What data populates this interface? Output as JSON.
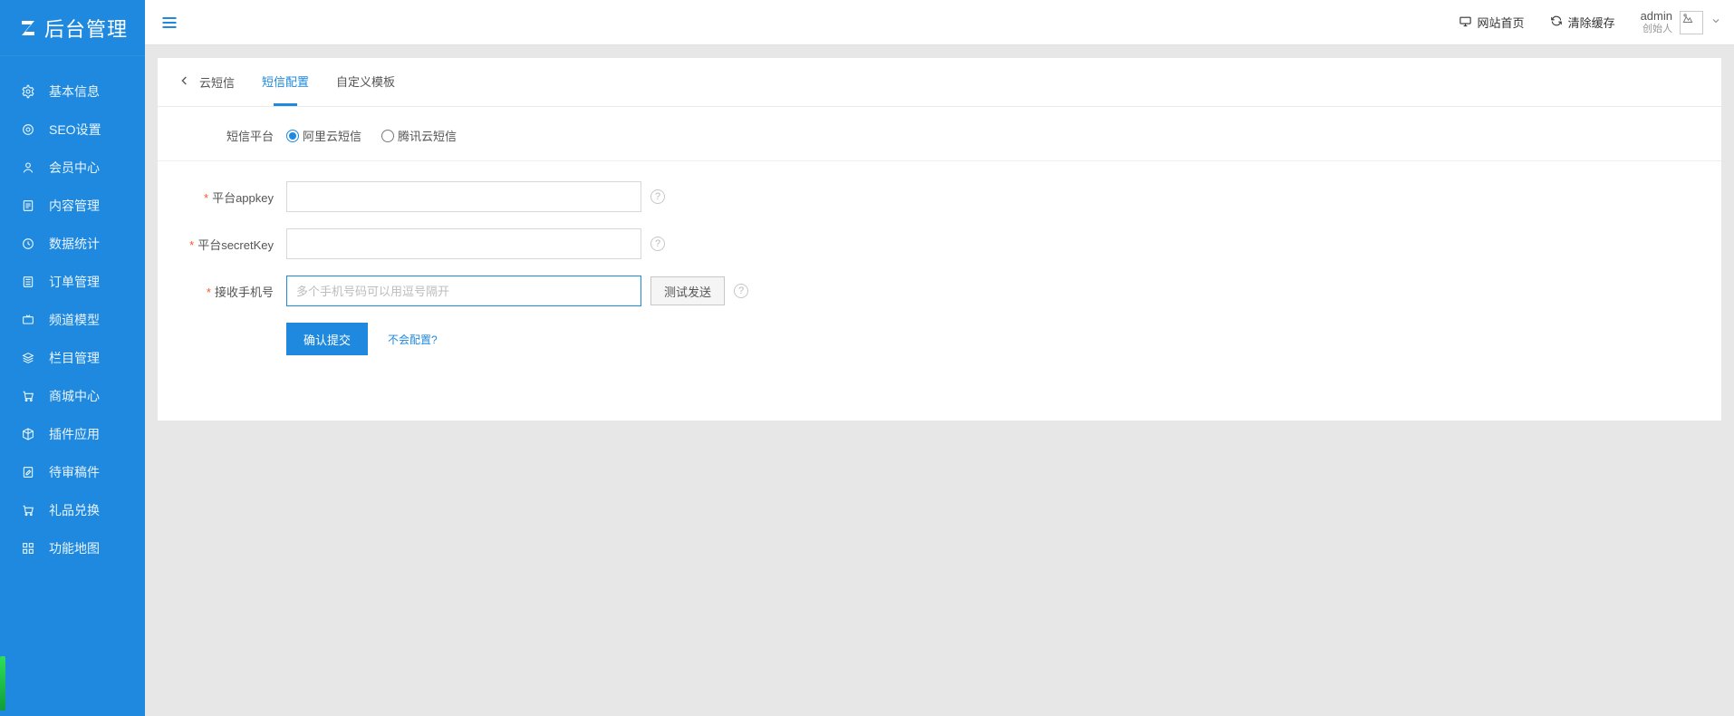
{
  "brand": {
    "text": "后台管理"
  },
  "sidebar": {
    "items": [
      {
        "label": "基本信息"
      },
      {
        "label": "SEO设置"
      },
      {
        "label": "会员中心"
      },
      {
        "label": "内容管理"
      },
      {
        "label": "数据统计"
      },
      {
        "label": "订单管理"
      },
      {
        "label": "频道模型"
      },
      {
        "label": "栏目管理"
      },
      {
        "label": "商城中心"
      },
      {
        "label": "插件应用"
      },
      {
        "label": "待审稿件"
      },
      {
        "label": "礼品兑换"
      },
      {
        "label": "功能地图"
      }
    ]
  },
  "topbar": {
    "home": "网站首页",
    "clear_cache": "清除缓存",
    "user_name": "admin",
    "user_role": "创始人"
  },
  "tabs": {
    "back": "云短信",
    "config": "短信配置",
    "template": "自定义模板"
  },
  "form": {
    "platform_label": "短信平台",
    "radio_aliyun": "阿里云短信",
    "radio_tencent": "腾讯云短信",
    "appkey_label": "平台appkey",
    "secret_label": "平台secretKey",
    "phone_label": "接收手机号",
    "phone_placeholder": "多个手机号码可以用逗号隔开",
    "test_btn": "测试发送",
    "submit_btn": "确认提交",
    "help_link": "不会配置?"
  }
}
